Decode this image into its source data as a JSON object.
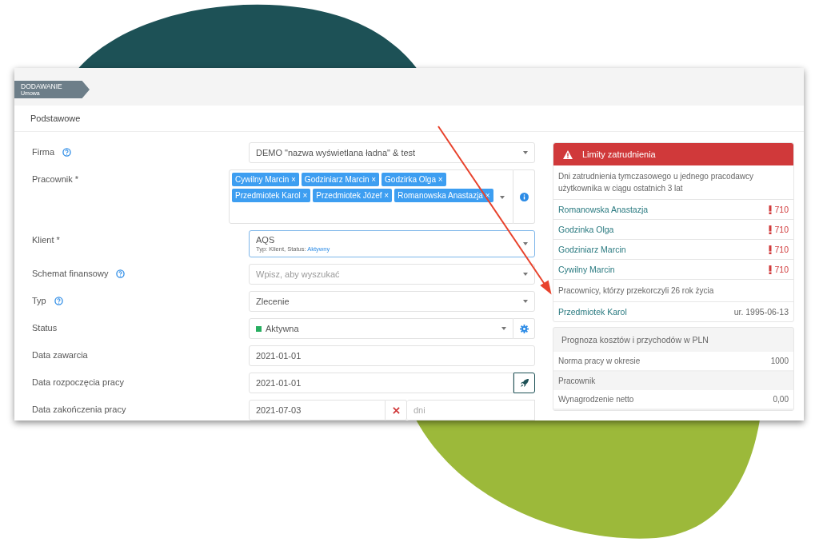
{
  "breadcrumb": {
    "title": "DODAWANIE",
    "subtitle": "Umowa"
  },
  "section": "Podstawowe",
  "fields": [
    {
      "kind": "select",
      "label": "Firma",
      "help": true,
      "value": "DEMO \"nazwa wyświetlana ładna\" & test"
    },
    {
      "kind": "tags",
      "label": "Pracownik *",
      "help": false,
      "tags": [
        "Cywilny Marcin",
        "Godziniarz Marcin",
        "Godzirka Olga",
        "Przedmiotek Karol",
        "Przedmiotek Józef",
        "Romanowska Anastazja"
      ],
      "remove": "×"
    },
    {
      "kind": "client",
      "label": "Klient *",
      "help": false,
      "value": "AQS",
      "meta": "Typ: Klient, Status: ",
      "meta_link": "Aktywny",
      "focused": true
    },
    {
      "kind": "select",
      "label": "Schemat finansowy",
      "help": true,
      "placeholder": "Wpisz, aby wyszukać"
    },
    {
      "kind": "select",
      "label": "Typ",
      "help": true,
      "value": "Zlecenie"
    },
    {
      "kind": "status",
      "label": "Status",
      "help": false,
      "value": "Aktywna",
      "color": "#27ae60"
    },
    {
      "kind": "text",
      "label": "Data zawarcia",
      "help": false,
      "value": "2021-01-01"
    },
    {
      "kind": "date-action",
      "label": "Data rozpoczęcia pracy",
      "help": false,
      "value": "2021-01-01"
    },
    {
      "kind": "date-range",
      "label": "Data zakończenia pracy",
      "help": false,
      "value": "2021-07-03",
      "placeholder": "dni"
    }
  ],
  "limits": {
    "title": "Limity zatrudnienia",
    "description": "Dni zatrudnienia tymczasowego u jednego pracodawcy użytkownika w ciągu ostatnich 3 lat",
    "rows": [
      {
        "name": "Romanowska Anastazja",
        "value": "710"
      },
      {
        "name": "Godzinka Olga",
        "value": "710"
      },
      {
        "name": "Godziniarz Marcin",
        "value": "710"
      },
      {
        "name": "Cywilny Marcin",
        "value": "710"
      }
    ],
    "age_note": "Pracownicy, którzy przekorczyli 26 rok życia",
    "age_rows": [
      {
        "name": "Przedmiotek Karol",
        "value": "ur. 1995-06-13"
      }
    ]
  },
  "forecast": {
    "title": "Prognoza kosztów i przychodów w PLN",
    "rows": [
      {
        "kind": "row",
        "label": "Norma pracy w okresie",
        "value": "1000"
      },
      {
        "kind": "group",
        "label": "Pracownik"
      },
      {
        "kind": "row",
        "label": "Wynagrodzenie netto",
        "value": "0,00"
      }
    ]
  }
}
